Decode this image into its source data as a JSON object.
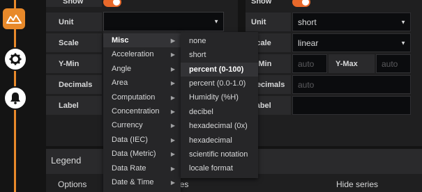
{
  "nav": {
    "items": [
      {
        "name": "visualization-icon"
      },
      {
        "name": "settings-gear-icon"
      },
      {
        "name": "alert-bell-icon"
      }
    ]
  },
  "left_axis": {
    "show_label": "Show",
    "unit_label": "Unit",
    "unit_value": "",
    "scale_label": "Scale",
    "ymin_label": "Y-Min",
    "decimals_label": "Decimals",
    "label_label": "Label"
  },
  "right_axis": {
    "show_label": "Show",
    "unit_label": "Unit",
    "unit_value": "short",
    "scale_label": "Scale",
    "scale_value": "linear",
    "ymin_label": "Y-Min",
    "ymin_placeholder": "auto",
    "ymax_label": "Y-Max",
    "ymax_placeholder": "auto",
    "decimals_label": "Decimals",
    "decimals_placeholder": "auto",
    "label_label": "Label"
  },
  "unit_categories": [
    "Misc",
    "Acceleration",
    "Angle",
    "Area",
    "Computation",
    "Concentration",
    "Currency",
    "Data (IEC)",
    "Data (Metric)",
    "Data Rate",
    "Date & Time"
  ],
  "misc_units": [
    "none",
    "short",
    "percent (0-100)",
    "percent (0.0-1.0)",
    "Humidity (%H)",
    "decibel",
    "hexadecimal (0x)",
    "hexadecimal",
    "scientific notation",
    "locale format"
  ],
  "legend": {
    "title": "Legend",
    "options_label": "Options",
    "values_label": "ies",
    "hide_series_label": "Hide series"
  },
  "colors": {
    "accent": "#e8892a",
    "background": "#141414",
    "panel": "#1f1f20"
  }
}
